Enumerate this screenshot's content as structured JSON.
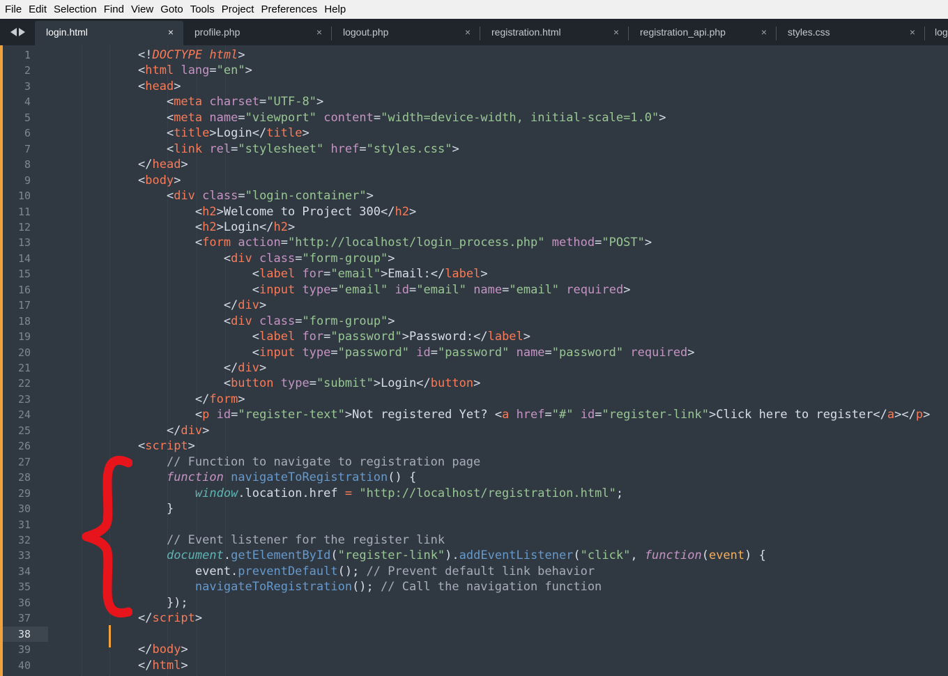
{
  "menu": [
    "File",
    "Edit",
    "Selection",
    "Find",
    "View",
    "Goto",
    "Tools",
    "Project",
    "Preferences",
    "Help"
  ],
  "tabs": [
    {
      "label": "login.html",
      "active": true
    },
    {
      "label": "profile.php",
      "active": false
    },
    {
      "label": "logout.php",
      "active": false
    },
    {
      "label": "registration.html",
      "active": false
    },
    {
      "label": "registration_api.php",
      "active": false
    },
    {
      "label": "styles.css",
      "active": false
    },
    {
      "label": "log",
      "active": false
    }
  ],
  "close_glyph": "×",
  "line_numbers": [
    "1",
    "2",
    "3",
    "4",
    "5",
    "6",
    "7",
    "8",
    "9",
    "10",
    "11",
    "12",
    "13",
    "14",
    "15",
    "16",
    "17",
    "18",
    "19",
    "20",
    "21",
    "22",
    "23",
    "24",
    "25",
    "26",
    "27",
    "28",
    "29",
    "30",
    "31",
    "32",
    "33",
    "34",
    "35",
    "36",
    "37",
    "38",
    "39",
    "40"
  ],
  "current_line": "38",
  "annotation": {
    "color": "#e8141c",
    "shape": "left-curly-brace"
  },
  "code": [
    [
      [
        "p",
        "<!"
      ],
      [
        "dt",
        "DOCTYPE"
      ],
      [
        "p",
        " "
      ],
      [
        "dt",
        "html"
      ],
      [
        "p",
        ">"
      ]
    ],
    [
      [
        "p",
        "<"
      ],
      [
        "t",
        "html"
      ],
      [
        "p",
        " "
      ],
      [
        "a",
        "lang"
      ],
      [
        "p",
        "="
      ],
      [
        "s",
        "\"en\""
      ],
      [
        "p",
        ">"
      ]
    ],
    [
      [
        "p",
        "<"
      ],
      [
        "t",
        "head"
      ],
      [
        "p",
        ">"
      ]
    ],
    [
      [
        "p",
        "    <"
      ],
      [
        "t",
        "meta"
      ],
      [
        "p",
        " "
      ],
      [
        "a",
        "charset"
      ],
      [
        "p",
        "="
      ],
      [
        "s",
        "\"UTF-8\""
      ],
      [
        "p",
        ">"
      ]
    ],
    [
      [
        "p",
        "    <"
      ],
      [
        "t",
        "meta"
      ],
      [
        "p",
        " "
      ],
      [
        "a",
        "name"
      ],
      [
        "p",
        "="
      ],
      [
        "s",
        "\"viewport\""
      ],
      [
        "p",
        " "
      ],
      [
        "a",
        "content"
      ],
      [
        "p",
        "="
      ],
      [
        "s",
        "\"width=device-width, initial-scale=1.0\""
      ],
      [
        "p",
        ">"
      ]
    ],
    [
      [
        "p",
        "    <"
      ],
      [
        "t",
        "title"
      ],
      [
        "p",
        ">Login</"
      ],
      [
        "t",
        "title"
      ],
      [
        "p",
        ">"
      ]
    ],
    [
      [
        "p",
        "    <"
      ],
      [
        "t",
        "link"
      ],
      [
        "p",
        " "
      ],
      [
        "a",
        "rel"
      ],
      [
        "p",
        "="
      ],
      [
        "s",
        "\"stylesheet\""
      ],
      [
        "p",
        " "
      ],
      [
        "a",
        "href"
      ],
      [
        "p",
        "="
      ],
      [
        "s",
        "\"styles.css\""
      ],
      [
        "p",
        ">"
      ]
    ],
    [
      [
        "p",
        "</"
      ],
      [
        "t",
        "head"
      ],
      [
        "p",
        ">"
      ]
    ],
    [
      [
        "p",
        "<"
      ],
      [
        "t",
        "body"
      ],
      [
        "p",
        ">"
      ]
    ],
    [
      [
        "p",
        "    <"
      ],
      [
        "t",
        "div"
      ],
      [
        "p",
        " "
      ],
      [
        "a",
        "class"
      ],
      [
        "p",
        "="
      ],
      [
        "s",
        "\"login-container\""
      ],
      [
        "p",
        ">"
      ]
    ],
    [
      [
        "p",
        "        <"
      ],
      [
        "t",
        "h2"
      ],
      [
        "p",
        ">Welcome to Project 300</"
      ],
      [
        "t",
        "h2"
      ],
      [
        "p",
        ">"
      ]
    ],
    [
      [
        "p",
        "        <"
      ],
      [
        "t",
        "h2"
      ],
      [
        "p",
        ">Login</"
      ],
      [
        "t",
        "h2"
      ],
      [
        "p",
        ">"
      ]
    ],
    [
      [
        "p",
        "        <"
      ],
      [
        "t",
        "form"
      ],
      [
        "p",
        " "
      ],
      [
        "a",
        "action"
      ],
      [
        "p",
        "="
      ],
      [
        "s",
        "\"http://localhost/login_process.php\""
      ],
      [
        "p",
        " "
      ],
      [
        "a",
        "method"
      ],
      [
        "p",
        "="
      ],
      [
        "s",
        "\"POST\""
      ],
      [
        "p",
        ">"
      ]
    ],
    [
      [
        "p",
        "            <"
      ],
      [
        "t",
        "div"
      ],
      [
        "p",
        " "
      ],
      [
        "a",
        "class"
      ],
      [
        "p",
        "="
      ],
      [
        "s",
        "\"form-group\""
      ],
      [
        "p",
        ">"
      ]
    ],
    [
      [
        "p",
        "                <"
      ],
      [
        "t",
        "label"
      ],
      [
        "p",
        " "
      ],
      [
        "a",
        "for"
      ],
      [
        "p",
        "="
      ],
      [
        "s",
        "\"email\""
      ],
      [
        "p",
        ">Email:</"
      ],
      [
        "t",
        "label"
      ],
      [
        "p",
        ">"
      ]
    ],
    [
      [
        "p",
        "                <"
      ],
      [
        "t",
        "input"
      ],
      [
        "p",
        " "
      ],
      [
        "a",
        "type"
      ],
      [
        "p",
        "="
      ],
      [
        "s",
        "\"email\""
      ],
      [
        "p",
        " "
      ],
      [
        "a",
        "id"
      ],
      [
        "p",
        "="
      ],
      [
        "s",
        "\"email\""
      ],
      [
        "p",
        " "
      ],
      [
        "a",
        "name"
      ],
      [
        "p",
        "="
      ],
      [
        "s",
        "\"email\""
      ],
      [
        "p",
        " "
      ],
      [
        "a",
        "required"
      ],
      [
        "p",
        ">"
      ]
    ],
    [
      [
        "p",
        "            </"
      ],
      [
        "t",
        "div"
      ],
      [
        "p",
        ">"
      ]
    ],
    [
      [
        "p",
        "            <"
      ],
      [
        "t",
        "div"
      ],
      [
        "p",
        " "
      ],
      [
        "a",
        "class"
      ],
      [
        "p",
        "="
      ],
      [
        "s",
        "\"form-group\""
      ],
      [
        "p",
        ">"
      ]
    ],
    [
      [
        "p",
        "                <"
      ],
      [
        "t",
        "label"
      ],
      [
        "p",
        " "
      ],
      [
        "a",
        "for"
      ],
      [
        "p",
        "="
      ],
      [
        "s",
        "\"password\""
      ],
      [
        "p",
        ">Password:</"
      ],
      [
        "t",
        "label"
      ],
      [
        "p",
        ">"
      ]
    ],
    [
      [
        "p",
        "                <"
      ],
      [
        "t",
        "input"
      ],
      [
        "p",
        " "
      ],
      [
        "a",
        "type"
      ],
      [
        "p",
        "="
      ],
      [
        "s",
        "\"password\""
      ],
      [
        "p",
        " "
      ],
      [
        "a",
        "id"
      ],
      [
        "p",
        "="
      ],
      [
        "s",
        "\"password\""
      ],
      [
        "p",
        " "
      ],
      [
        "a",
        "name"
      ],
      [
        "p",
        "="
      ],
      [
        "s",
        "\"password\""
      ],
      [
        "p",
        " "
      ],
      [
        "a",
        "required"
      ],
      [
        "p",
        ">"
      ]
    ],
    [
      [
        "p",
        "            </"
      ],
      [
        "t",
        "div"
      ],
      [
        "p",
        ">"
      ]
    ],
    [
      [
        "p",
        "            <"
      ],
      [
        "t",
        "button"
      ],
      [
        "p",
        " "
      ],
      [
        "a",
        "type"
      ],
      [
        "p",
        "="
      ],
      [
        "s",
        "\"submit\""
      ],
      [
        "p",
        ">Login</"
      ],
      [
        "t",
        "button"
      ],
      [
        "p",
        ">"
      ]
    ],
    [
      [
        "p",
        "        </"
      ],
      [
        "t",
        "form"
      ],
      [
        "p",
        ">"
      ]
    ],
    [
      [
        "p",
        "        <"
      ],
      [
        "t",
        "p"
      ],
      [
        "p",
        " "
      ],
      [
        "a",
        "id"
      ],
      [
        "p",
        "="
      ],
      [
        "s",
        "\"register-text\""
      ],
      [
        "p",
        ">Not registered Yet? <"
      ],
      [
        "t",
        "a"
      ],
      [
        "p",
        " "
      ],
      [
        "a",
        "href"
      ],
      [
        "p",
        "="
      ],
      [
        "s",
        "\"#\""
      ],
      [
        "p",
        " "
      ],
      [
        "a",
        "id"
      ],
      [
        "p",
        "="
      ],
      [
        "s",
        "\"register-link\""
      ],
      [
        "p",
        ">Click here to register</"
      ],
      [
        "t",
        "a"
      ],
      [
        "p",
        "></"
      ],
      [
        "t",
        "p"
      ],
      [
        "p",
        ">"
      ]
    ],
    [
      [
        "p",
        "    </"
      ],
      [
        "t",
        "div"
      ],
      [
        "p",
        ">"
      ]
    ],
    [
      [
        "p",
        "<"
      ],
      [
        "t",
        "script"
      ],
      [
        "p",
        ">"
      ]
    ],
    [
      [
        "c",
        "    // Function to navigate to registration page"
      ]
    ],
    [
      [
        "p",
        "    "
      ],
      [
        "k",
        "function"
      ],
      [
        "p",
        " "
      ],
      [
        "f",
        "navigateToRegistration"
      ],
      [
        "p",
        "() {"
      ]
    ],
    [
      [
        "p",
        "        "
      ],
      [
        "w",
        "window"
      ],
      [
        "p",
        ".location.href "
      ],
      [
        "op",
        "="
      ],
      [
        "p",
        " "
      ],
      [
        "s",
        "\"http://localhost/registration.html\""
      ],
      [
        "p",
        ";"
      ]
    ],
    [
      [
        "p",
        "    }"
      ]
    ],
    [],
    [
      [
        "c",
        "    // Event listener for the register link"
      ]
    ],
    [
      [
        "p",
        "    "
      ],
      [
        "w",
        "document"
      ],
      [
        "p",
        "."
      ],
      [
        "f",
        "getElementById"
      ],
      [
        "p",
        "("
      ],
      [
        "s",
        "\"register-link\""
      ],
      [
        "p",
        ")."
      ],
      [
        "f",
        "addEventListener"
      ],
      [
        "p",
        "("
      ],
      [
        "s",
        "\"click\""
      ],
      [
        "p",
        ", "
      ],
      [
        "k",
        "function"
      ],
      [
        "p",
        "("
      ],
      [
        "v",
        "event"
      ],
      [
        "p",
        ") {"
      ]
    ],
    [
      [
        "p",
        "        event."
      ],
      [
        "f",
        "preventDefault"
      ],
      [
        "p",
        "(); "
      ],
      [
        "c",
        "// Prevent default link behavior"
      ]
    ],
    [
      [
        "p",
        "        "
      ],
      [
        "f",
        "navigateToRegistration"
      ],
      [
        "p",
        "(); "
      ],
      [
        "c",
        "// Call the navigation function"
      ]
    ],
    [
      [
        "p",
        "    });"
      ]
    ],
    [
      [
        "p",
        "</"
      ],
      [
        "t",
        "script"
      ],
      [
        "p",
        ">"
      ]
    ],
    [],
    [
      [
        "p",
        "</"
      ],
      [
        "t",
        "body"
      ],
      [
        "p",
        ">"
      ]
    ],
    [
      [
        "p",
        "</"
      ],
      [
        "t",
        "html"
      ],
      [
        "p",
        ">"
      ]
    ]
  ]
}
